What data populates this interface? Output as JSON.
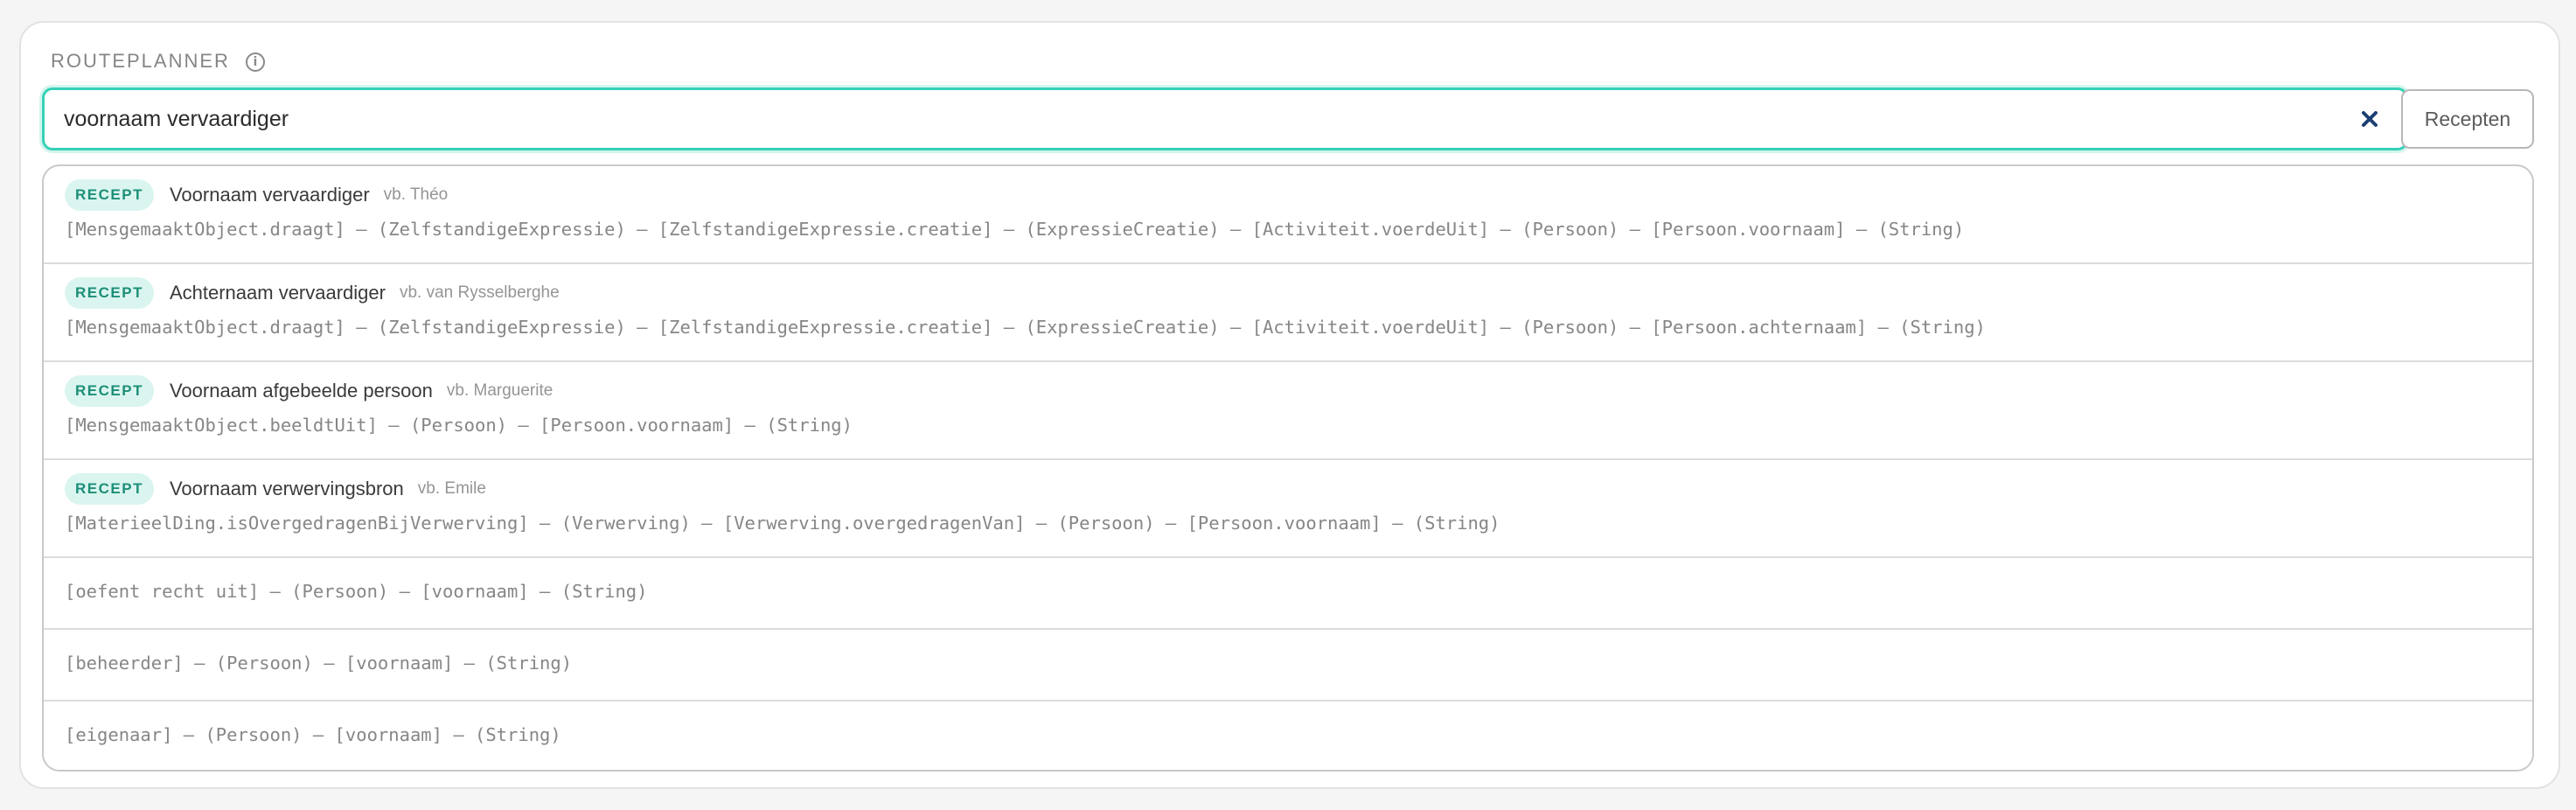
{
  "header": {
    "title": "ROUTEPLANNER",
    "info_icon": "info-icon"
  },
  "search": {
    "value": "voornaam vervaardiger",
    "clear_icon": "close-icon"
  },
  "buttons": {
    "recepten": "Recepten"
  },
  "colors": {
    "accent": "#35d1b6",
    "badge_bg": "#daf5ef",
    "badge_text": "#1c8e78",
    "clear_icon": "#1c3f73"
  },
  "suggestions": [
    {
      "badge": "RECEPT",
      "name": "Voornaam vervaardiger",
      "example": "vb. Théo",
      "path": "[MensgemaaktObject.draagt] — (ZelfstandigeExpressie) — [ZelfstandigeExpressie.creatie] — (ExpressieCreatie) — [Activiteit.voerdeUit] — (Persoon) — [Persoon.voornaam] — (String)"
    },
    {
      "badge": "RECEPT",
      "name": "Achternaam vervaardiger",
      "example": "vb. van Rysselberghe",
      "path": "[MensgemaaktObject.draagt] — (ZelfstandigeExpressie) — [ZelfstandigeExpressie.creatie] — (ExpressieCreatie) — [Activiteit.voerdeUit] — (Persoon) — [Persoon.achternaam] — (String)"
    },
    {
      "badge": "RECEPT",
      "name": "Voornaam afgebeelde persoon",
      "example": "vb. Marguerite",
      "path": "[MensgemaaktObject.beeldtUit] — (Persoon) — [Persoon.voornaam] — (String)"
    },
    {
      "badge": "RECEPT",
      "name": "Voornaam verwervingsbron",
      "example": "vb. Emile",
      "path": "[MaterieelDing.isOvergedragenBijVerwerving] — (Verwerving) — [Verwerving.overgedragenVan] — (Persoon) — [Persoon.voornaam] — (String)"
    },
    {
      "path": "[oefent recht uit] — (Persoon) — [voornaam] — (String)"
    },
    {
      "path": "[beheerder] — (Persoon) — [voornaam] — (String)"
    },
    {
      "path": "[eigenaar] — (Persoon) — [voornaam] — (String)"
    }
  ]
}
